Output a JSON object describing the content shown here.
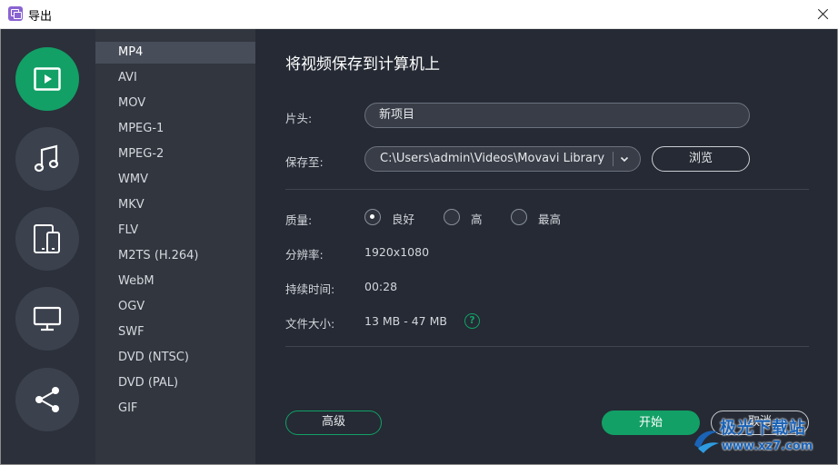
{
  "window": {
    "title": "导出"
  },
  "categories": [
    {
      "name": "video",
      "icon": "play-icon",
      "active": true
    },
    {
      "name": "audio",
      "icon": "music-note-icon",
      "active": false
    },
    {
      "name": "devices",
      "icon": "devices-icon",
      "active": false
    },
    {
      "name": "tv",
      "icon": "monitor-icon",
      "active": false
    },
    {
      "name": "share",
      "icon": "share-icon",
      "active": false
    }
  ],
  "formats": [
    "MP4",
    "AVI",
    "MOV",
    "MPEG-1",
    "MPEG-2",
    "WMV",
    "MKV",
    "FLV",
    "M2TS (H.264)",
    "WebM",
    "OGV",
    "SWF",
    "DVD (NTSC)",
    "DVD (PAL)",
    "GIF"
  ],
  "selected_format": "MP4",
  "main": {
    "heading": "将视频保存到计算机上",
    "title_label": "片头:",
    "title_value": "新项目",
    "save_label": "保存至:",
    "save_path": "C:\\Users\\admin\\Videos\\Movavi Library",
    "browse_label": "浏览",
    "quality_label": "质量:",
    "quality_options": [
      {
        "label": "良好",
        "checked": true
      },
      {
        "label": "高",
        "checked": false
      },
      {
        "label": "最高",
        "checked": false
      }
    ],
    "resolution_label": "分辨率:",
    "resolution_value": "1920x1080",
    "duration_label": "持续时间:",
    "duration_value": "00:28",
    "filesize_label": "文件大小:",
    "filesize_value": "13 MB - 47 MB",
    "help_glyph": "?"
  },
  "footer": {
    "advanced_label": "高级",
    "start_label": "开始",
    "cancel_label": "取消"
  },
  "watermark": {
    "text": "极光下载站",
    "url": "www.xz7.com"
  },
  "colors": {
    "accent": "#12a066",
    "background": "#252a34",
    "list_bg": "#31363f",
    "selected_row": "#474d59"
  }
}
